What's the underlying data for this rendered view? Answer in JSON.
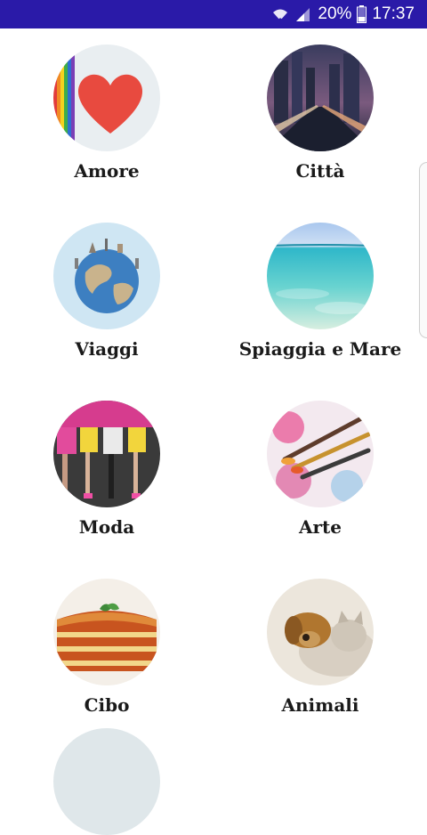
{
  "status_bar": {
    "battery": "20%",
    "time": "17:37",
    "background": "#2a1aa8"
  },
  "categories": [
    {
      "label": "Amore",
      "icon": "heart-rainbow-icon"
    },
    {
      "label": "Città",
      "icon": "city-night-image"
    },
    {
      "label": "Viaggi",
      "icon": "globe-landmarks-image"
    },
    {
      "label": "Spiaggia e Mare",
      "icon": "beach-sea-image"
    },
    {
      "label": "Moda",
      "icon": "fashion-models-image"
    },
    {
      "label": "Arte",
      "icon": "paintbrushes-image"
    },
    {
      "label": "Cibo",
      "icon": "lasagna-image"
    },
    {
      "label": "Animali",
      "icon": "puppy-kitten-image"
    }
  ]
}
